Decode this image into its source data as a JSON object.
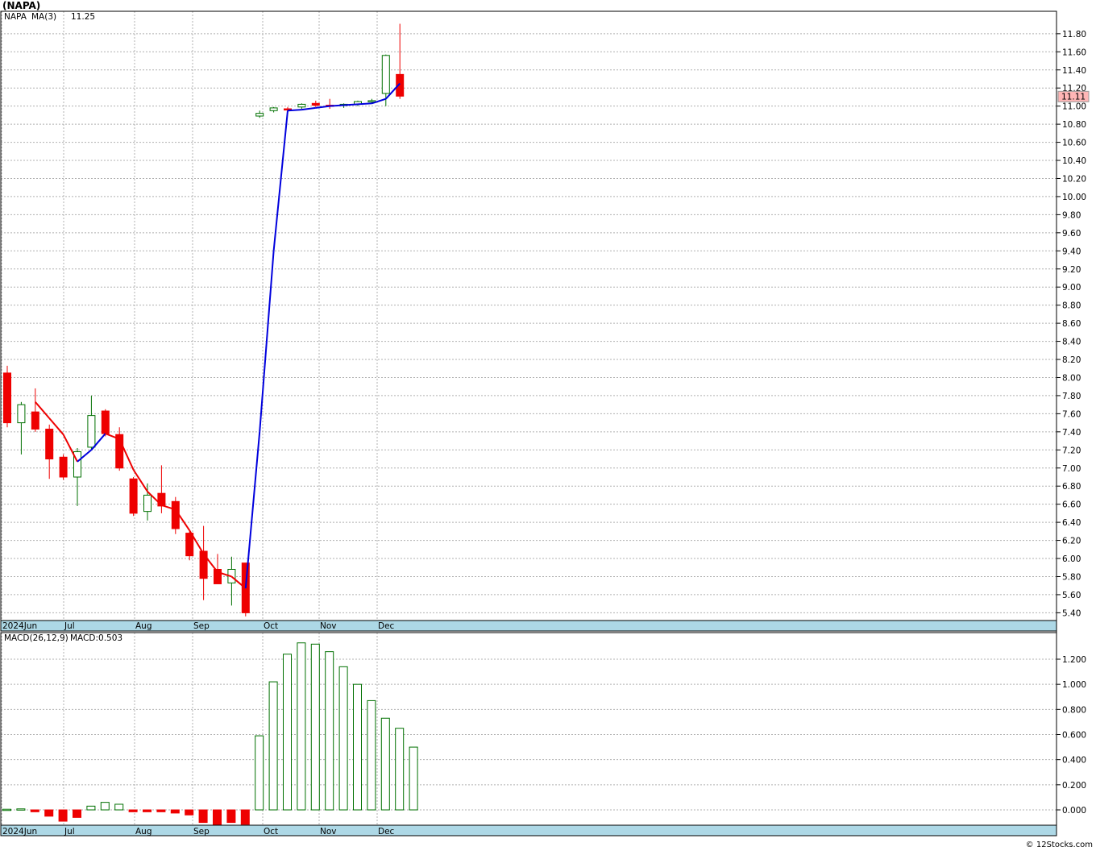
{
  "title": "(NAPA)",
  "credit": "© 12Stocks.com",
  "colors": {
    "up": "#007000",
    "down": "#ee0000",
    "ma_up": "#0000dd",
    "ma_down": "#ee0000",
    "grid": "#b0b0b0",
    "axis_band": "#add8e6",
    "last_price_bg": "#ffb6b6"
  },
  "price_legend": {
    "symbol": "NAPA",
    "ma_label": "MA(3)",
    "ma_value": "11.25"
  },
  "last_price_tag": "11.11",
  "macd_legend": {
    "label": "MACD(26,12,9)",
    "value_label": "MACD:0.503"
  },
  "x_axis_labels": [
    "2024Jun",
    "Jul",
    "Aug",
    "Sep",
    "Oct",
    "Nov",
    "Dec"
  ],
  "chart_data": [
    {
      "type": "candlestick",
      "title": "(NAPA)",
      "ylim": [
        5.35,
        11.95
      ],
      "y_ticks": [
        "5.40",
        "5.60",
        "5.80",
        "6.00",
        "6.20",
        "6.40",
        "6.60",
        "6.80",
        "7.00",
        "7.20",
        "7.40",
        "7.60",
        "7.80",
        "8.00",
        "8.20",
        "8.40",
        "8.60",
        "8.80",
        "9.00",
        "9.20",
        "9.40",
        "9.60",
        "9.80",
        "10.00",
        "10.20",
        "10.40",
        "10.60",
        "10.80",
        "11.00",
        "11.20",
        "11.40",
        "11.60",
        "11.80"
      ],
      "grid": true,
      "candles": [
        {
          "o": 8.05,
          "h": 8.13,
          "l": 7.45,
          "c": 7.5
        },
        {
          "o": 7.5,
          "h": 7.73,
          "l": 7.15,
          "c": 7.7
        },
        {
          "o": 7.62,
          "h": 7.88,
          "l": 7.4,
          "c": 7.43
        },
        {
          "o": 7.43,
          "h": 7.48,
          "l": 6.88,
          "c": 7.1
        },
        {
          "o": 7.12,
          "h": 7.15,
          "l": 6.87,
          "c": 6.9
        },
        {
          "o": 6.9,
          "h": 7.22,
          "l": 6.58,
          "c": 7.18
        },
        {
          "o": 7.23,
          "h": 7.8,
          "l": 7.2,
          "c": 7.58
        },
        {
          "o": 7.63,
          "h": 7.65,
          "l": 7.35,
          "c": 7.38
        },
        {
          "o": 7.37,
          "h": 7.45,
          "l": 6.97,
          "c": 7.0
        },
        {
          "o": 6.88,
          "h": 6.9,
          "l": 6.47,
          "c": 6.5
        },
        {
          "o": 6.52,
          "h": 6.83,
          "l": 6.42,
          "c": 6.7
        },
        {
          "o": 6.72,
          "h": 7.03,
          "l": 6.5,
          "c": 6.58
        },
        {
          "o": 6.63,
          "h": 6.68,
          "l": 6.27,
          "c": 6.33
        },
        {
          "o": 6.28,
          "h": 6.3,
          "l": 5.98,
          "c": 6.03
        },
        {
          "o": 6.08,
          "h": 6.36,
          "l": 5.54,
          "c": 5.78
        },
        {
          "o": 5.88,
          "h": 6.05,
          "l": 5.73,
          "c": 5.72
        },
        {
          "o": 5.73,
          "h": 6.02,
          "l": 5.48,
          "c": 5.88
        },
        {
          "o": 5.95,
          "h": 5.95,
          "l": 5.36,
          "c": 5.4
        },
        {
          "o": 10.89,
          "h": 10.95,
          "l": 10.87,
          "c": 10.92
        },
        {
          "o": 10.95,
          "h": 10.99,
          "l": 10.93,
          "c": 10.98
        },
        {
          "o": 10.97,
          "h": 10.99,
          "l": 10.95,
          "c": 10.96
        },
        {
          "o": 10.99,
          "h": 11.03,
          "l": 10.97,
          "c": 11.02
        },
        {
          "o": 11.03,
          "h": 11.06,
          "l": 10.99,
          "c": 11.01
        },
        {
          "o": 11.01,
          "h": 11.08,
          "l": 10.97,
          "c": 11.0
        },
        {
          "o": 11.01,
          "h": 11.03,
          "l": 10.98,
          "c": 11.02
        },
        {
          "o": 11.02,
          "h": 11.06,
          "l": 11.0,
          "c": 11.05
        },
        {
          "o": 11.05,
          "h": 11.08,
          "l": 11.03,
          "c": 11.06
        },
        {
          "o": 11.14,
          "h": 11.57,
          "l": 11.0,
          "c": 11.56
        },
        {
          "o": 11.35,
          "h": 11.91,
          "l": 11.08,
          "c": 11.11
        }
      ],
      "ma3": [
        null,
        null,
        7.73,
        7.55,
        7.37,
        7.07,
        7.2,
        7.38,
        7.32,
        6.98,
        6.74,
        6.59,
        6.54,
        6.31,
        6.05,
        5.85,
        5.8,
        5.67,
        7.4,
        9.4,
        10.95,
        10.96,
        10.98,
        11.0,
        11.01,
        11.02,
        11.03,
        11.08,
        11.25
      ]
    },
    {
      "type": "bar",
      "title": "MACD(26,12,9)",
      "ylim": [
        -0.13,
        1.36
      ],
      "y_ticks": [
        "0.000",
        "0.200",
        "0.400",
        "0.600",
        "0.800",
        "1.000",
        "1.200"
      ],
      "values": [
        0.005,
        0.008,
        -0.015,
        -0.05,
        -0.09,
        -0.06,
        0.03,
        0.06,
        0.045,
        -0.015,
        -0.015,
        -0.015,
        -0.025,
        -0.04,
        -0.1,
        -0.12,
        -0.1,
        -0.115,
        0.59,
        1.02,
        1.24,
        1.33,
        1.32,
        1.26,
        1.14,
        1.0,
        0.87,
        0.73,
        0.65,
        0.5
      ]
    }
  ]
}
